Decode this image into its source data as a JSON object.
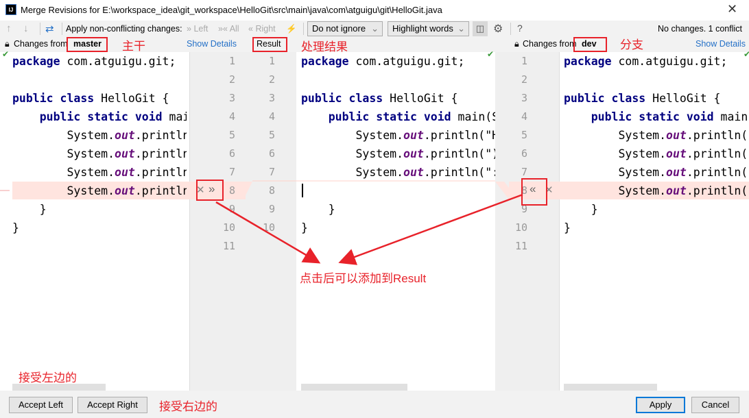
{
  "window": {
    "title": "Merge Revisions for E:\\workspace_idea\\git_workspace\\HelloGit\\src\\main\\java\\com\\atguigu\\git\\HelloGit.java",
    "logo": "IJ",
    "close_icon": "close-icon"
  },
  "toolbar": {
    "apply_label": "Apply non-conflicting changes:",
    "left": "Left",
    "all": "All",
    "right": "Right",
    "ignore_select": "Do not ignore",
    "highlight_select": "Highlight words",
    "help": "?",
    "status": "No changes. 1 conflict"
  },
  "left": {
    "changes_from": "Changes from",
    "branch": "master",
    "show_details": "Show Details"
  },
  "center": {
    "label": "Result"
  },
  "right": {
    "changes_from": "Changes from",
    "branch": "dev",
    "show_details": "Show Details"
  },
  "code": {
    "left": [
      "package com.atguigu.git;",
      "",
      "public class HelloGit {",
      "    public static void main(String[] args) {",
      "        System.out.println(",
      "        System.out.println(",
      "        System.out.println(",
      "        System.out.println(",
      "    }",
      "}",
      ""
    ],
    "result": [
      "package com.atguigu.git;",
      "",
      "public class HelloGit {",
      "    public static void main(String[] args) {",
      "        System.out.println(\"H",
      "        System.out.println(\")",
      "        System.out.println(\":",
      "",
      "    }",
      "}",
      ""
    ],
    "right": [
      "package com.atguigu.git;",
      "",
      "public class HelloGit {",
      "    public static void main(String[] args) {",
      "        System.out.println(",
      "        System.out.println(",
      "        System.out.println(",
      "        System.out.println(",
      "    }",
      "}",
      ""
    ],
    "left_line_numbers": [
      "1",
      "2",
      "3",
      "4",
      "5",
      "6",
      "7",
      "8",
      "9",
      "10",
      "11"
    ],
    "result_line_numbers": [
      "1",
      "2",
      "3",
      "4",
      "5",
      "6",
      "7",
      "8",
      "9",
      "10"
    ],
    "right_line_numbers": [
      "1",
      "2",
      "3",
      "4",
      "5",
      "6",
      "7",
      "8",
      "9",
      "10",
      "11"
    ]
  },
  "buttons": {
    "accept_left": "Accept Left",
    "accept_right": "Accept Right",
    "apply": "Apply",
    "cancel": "Cancel"
  },
  "annotations": {
    "master": "主干",
    "result": "处理结果",
    "dev": "分支",
    "click_add": "点击后可以添加到Result",
    "accept_left": "接受左边的",
    "accept_right": "接受右边的"
  },
  "colors": {
    "conflict": "#ffe4df",
    "annotation": "#e8222a",
    "link": "#2470c7",
    "keyword": "#000080",
    "field": "#660e7a"
  }
}
